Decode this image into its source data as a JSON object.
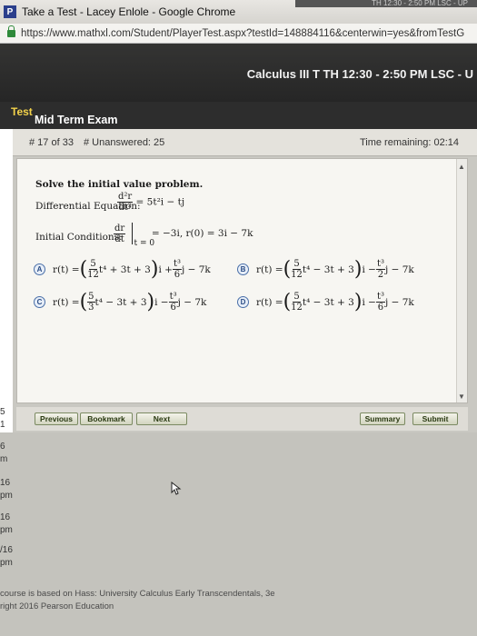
{
  "window": {
    "title": "Take a Test - Lacey Enlole - Google Chrome",
    "app_icon": "P",
    "ghost_text": "TH 12:30 - 2:50 PM LSC - UP"
  },
  "address": {
    "url": "https://www.mathxl.com/Student/PlayerTest.aspx?testId=148884116&centerwin=yes&fromTestG"
  },
  "banner": {
    "course": "Calculus III T TH 12:30 - 2:50 PM LSC - U"
  },
  "test": {
    "label": "Test",
    "title": "Mid Term Exam",
    "question_number": "# 17 of 33",
    "unanswered": "# Unanswered: 25",
    "time_remaining": "Time remaining: 02:14"
  },
  "question": {
    "intro": "Solve the initial value problem.",
    "de_label": "Differential Equation:",
    "de_num": "d²r",
    "de_den": "dt²",
    "de_rhs": "= 5t²i − tj",
    "ic_label": "Initial Conditions:",
    "ic_num": "dr",
    "ic_den": "dt",
    "ic_sub": "t = 0",
    "ic_rhs": "= −3i, r(0) = 3i − 7k",
    "options": [
      {
        "letter": "A",
        "lhs": "r(t) =",
        "f1n": "5",
        "f1d": "12",
        "mid": "t⁴ + 3t + 3",
        "close": "i +",
        "f2n": "t³",
        "f2d": "6",
        "tail": "j − 7k"
      },
      {
        "letter": "B",
        "lhs": "r(t) =",
        "f1n": "5",
        "f1d": "12",
        "mid": "t⁴ − 3t + 3",
        "close": "i −",
        "f2n": "t³",
        "f2d": "2",
        "tail": "j − 7k"
      },
      {
        "letter": "C",
        "lhs": "r(t) =",
        "f1n": "5",
        "f1d": "3",
        "mid": "t⁴ − 3t + 3",
        "close": "i −",
        "f2n": "t³",
        "f2d": "6",
        "tail": "j − 7k"
      },
      {
        "letter": "D",
        "lhs": "r(t) =",
        "f1n": "5",
        "f1d": "12",
        "mid": "t⁴ − 3t + 3",
        "close": "i −",
        "f2n": "t³",
        "f2d": "6",
        "tail": "j − 7k"
      }
    ]
  },
  "buttons": {
    "previous": "Previous",
    "bookmark": "Bookmark",
    "next": "Next",
    "summary": "Summary",
    "submit": "Submit"
  },
  "side_fragments": [
    "5",
    "1",
    "6",
    "m",
    "16",
    "pm",
    "16",
    "pm",
    "/16",
    "pm"
  ],
  "footer": {
    "line1": "course is based on Hass: University Calculus Early Transcendentals, 3e",
    "line2": "right 2016 Pearson Education"
  },
  "colors": {
    "test_label": "#f3d24a",
    "banner": "#2b2b2b",
    "panel": "#f7f6f2"
  }
}
